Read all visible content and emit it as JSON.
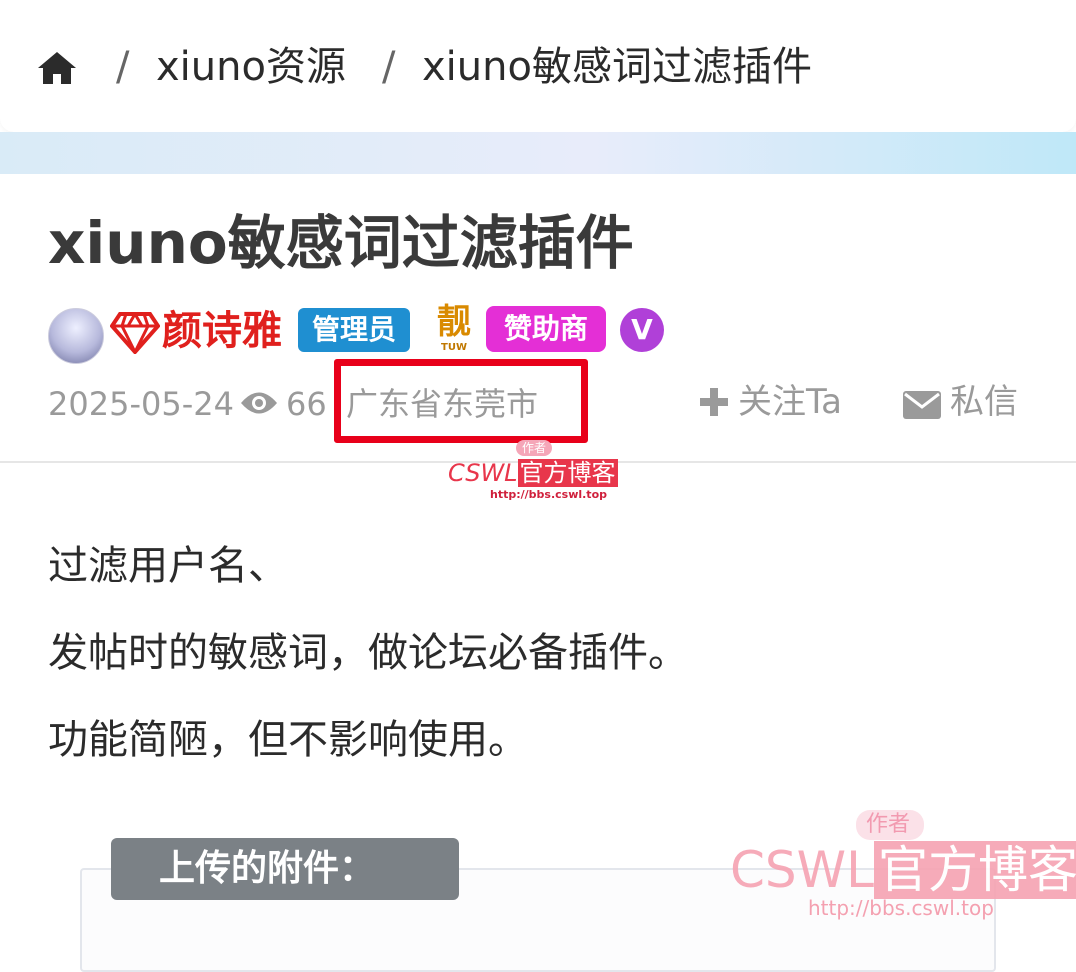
{
  "breadcrumb": {
    "items": [
      "xiuno资源",
      "xiuno敏感词过滤插件"
    ],
    "separator": "/"
  },
  "post": {
    "title": "xiuno敏感词过滤插件",
    "author": {
      "name": "颜诗雅",
      "badges": [
        "管理员",
        "靓",
        "赞助商",
        "V"
      ],
      "liang_sub": "TUW"
    },
    "meta": {
      "date": "2025-05-24",
      "views": "66",
      "location": "广东省东莞市"
    },
    "actions": {
      "follow": "关注Ta",
      "message": "私信"
    },
    "body": [
      "过滤用户名、",
      "发帖时的敏感词，做论坛必备插件。",
      "功能简陋，但不影响使用。"
    ],
    "attachments_label": "上传的附件："
  },
  "watermark": {
    "tag": "作者",
    "brand_latin": "CSWL",
    "brand_cn": "官方博客",
    "url": "http://bbs.cswl.top"
  },
  "colors": {
    "username": "#e0201d",
    "admin_badge": "#1f8fd1",
    "sponsor_badge": "#e42fd6",
    "highlight": "#e8001a"
  }
}
